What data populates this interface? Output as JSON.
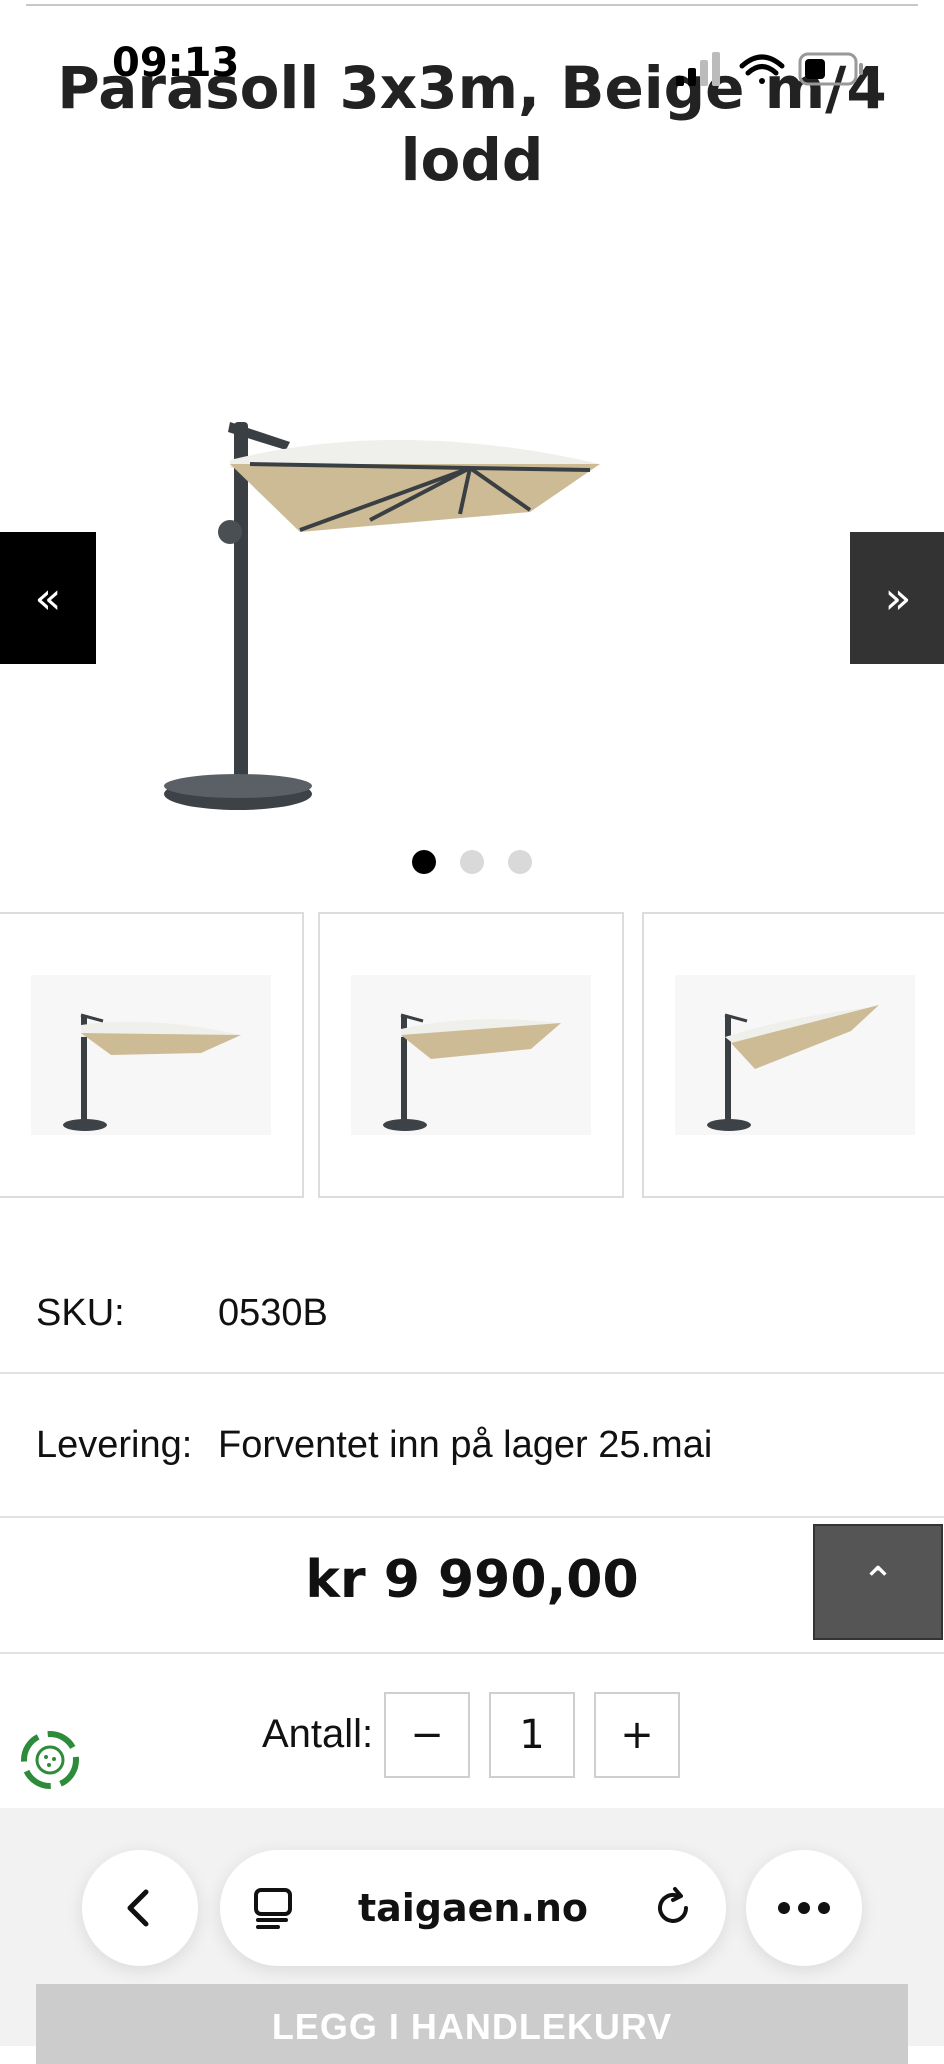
{
  "status_bar": {
    "time": "09:13"
  },
  "product": {
    "title": "Parasoll 3x3m, Beige m/4 lodd",
    "sku_label": "SKU:",
    "sku_value": "0530B",
    "delivery_label": "Levering:",
    "delivery_value": "Forventet inn på lager 25.mai",
    "price": "kr 9 990,00"
  },
  "gallery": {
    "prev_label": "«",
    "next_label": "»",
    "dot_count": 3,
    "active_dot": 0,
    "thumbnail_count": 3
  },
  "quantity": {
    "label": "Antall:",
    "minus": "−",
    "value": "1",
    "plus": "+"
  },
  "scroll_top_label": "⌃",
  "cart": {
    "label": "LEGG I HANDLEKURV"
  },
  "browser": {
    "url": "taigaen.no"
  },
  "colors": {
    "canopy": "#cdbb95",
    "canopy_top": "#efefeb",
    "pole": "#3a3f44",
    "eco_green": "#2e8b3a"
  }
}
